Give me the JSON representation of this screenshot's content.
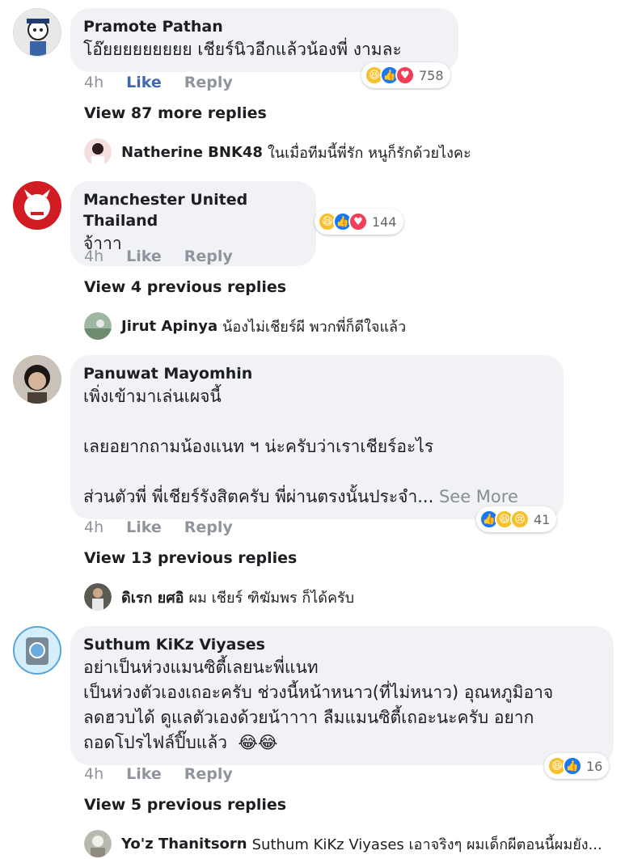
{
  "comments": [
    {
      "author": "Pramote Pathan",
      "text": "โอ๊ยยยยยยยยย เชียร์นิวอีกแล้วน้องพี่ งามละ",
      "time": "4h",
      "like": "Like",
      "reply": "Reply",
      "like_active": true,
      "reaction_count": "758",
      "reaction_icons": [
        "haha-icon",
        "like-icon",
        "love-icon"
      ],
      "view_replies": "View 87 more replies",
      "top_reply": {
        "author": "Natherine BNK48",
        "text": "ในเมื่อทีมนี้พี่รัก หนูก็รักด้วยไงคะ"
      }
    },
    {
      "author": "Manchester United Thailand",
      "text": "จ้าาา",
      "time": "4h",
      "like": "Like",
      "reply": "Reply",
      "like_active": false,
      "reaction_count": "144",
      "reaction_icons": [
        "haha-icon",
        "like-icon",
        "love-icon"
      ],
      "view_replies": "View 4 previous replies",
      "top_reply": {
        "author": "Jirut Apinya",
        "text": "น้องไม่เชียร์ผี พวกพี่ก็ดีใจแล้ว"
      }
    },
    {
      "author": "Panuwat Mayomhin",
      "text": "เพิ่งเข้ามาเล่นเผจนี้\n\nเลยอยากถามน้องแนท ฯ น่ะครับว่าเราเชียร์อะไร\n\nส่วนตัวพี่ พี่เชียร์รังสิตครับ พี่ผ่านตรงนั้นประจำ...",
      "see_more": " See More",
      "time": "4h",
      "like": "Like",
      "reply": "Reply",
      "like_active": false,
      "reaction_count": "41",
      "reaction_icons": [
        "like-icon",
        "haha-icon",
        "sad-icon"
      ],
      "view_replies": "View 13 previous replies",
      "top_reply": {
        "author": "ดิเรก ยศอิ",
        "text": "ผม เชียร์ ฑิฆัมพร ก็ได้ครับ"
      }
    },
    {
      "author": "Suthum KiKz Viyases",
      "text": "อย่าเป็นห่วงแมนซิตี้เลยนะพี่แนท\nเป็นห่วงตัวเองเถอะครับ ช่วงนี้หน้าหนาว(ที่ไม่หนาว) อุณหภูมิอาจ\nลดฮวบได้ ดูแลตัวเองด้วยน้าาาา ลืมแมนซิตี้เถอะนะครับ อยาก\nถอดโปรไฟล์ปิ๊บแล้ว  😂😂",
      "time": "4h",
      "like": "Like",
      "reply": "Reply",
      "like_active": false,
      "reaction_count": "16",
      "reaction_icons": [
        "haha-icon",
        "like-icon"
      ],
      "view_replies": "View 5 previous replies",
      "top_reply": {
        "author": "Yo'z Thanitsorn",
        "text": "Suthum KiKz Viyases เอาจริงๆ ผมเด็กผีตอนนี้ผมยัง..."
      }
    }
  ]
}
